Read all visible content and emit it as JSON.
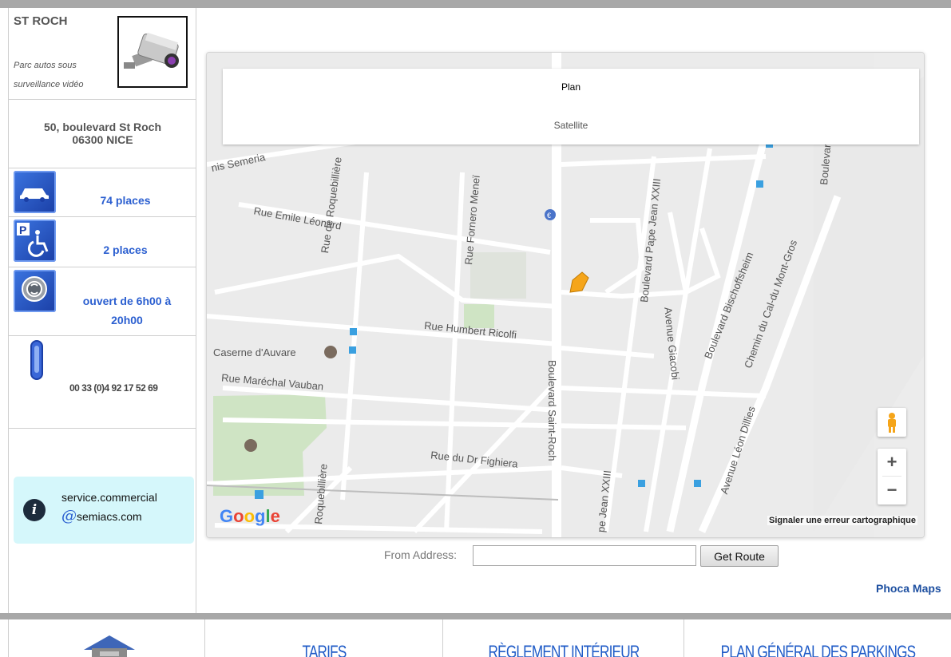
{
  "parking": {
    "name": "ST ROCH",
    "tagline_1": "Parc autos sous",
    "tagline_2": "surveillance vidéo",
    "address_line1": "50, boulevard St Roch",
    "address_line2": "06300 NICE",
    "places": "74 places",
    "disabled_places": "2 places",
    "hours_line1": "ouvert de 6h00 à",
    "hours_line2": "20h00",
    "phone": "00 33 (0)4 92 17 52 69",
    "email_user": "service.commercial",
    "email_domain": "semiacs.com",
    "email_at": "@"
  },
  "map": {
    "type_plan": "Plan",
    "type_satellite": "Satellite",
    "report_link": "Signaler une erreur cartographique",
    "zoom_in": "+",
    "zoom_out": "−",
    "google_g": "G",
    "google_o1": "o",
    "google_o2": "o",
    "google_g2": "g",
    "google_l": "l",
    "google_e": "e",
    "streets": {
      "s1": "nis Semeria",
      "s2": "Rue Emile Léonard",
      "s3": "Rue de Roquebillière",
      "s4": "Rue Fornero Meneï",
      "s5": "Boulevard Pape Jean XXIII",
      "s6": "Boulevard Bischoffsheim",
      "s7": "Chemin du Cal-du Mont-Gros",
      "s8": "Avenue Giacobi",
      "s9": "Rue Humbert Ricolfi",
      "s10": "Caserne d'Auvare",
      "s11": "Rue Maréchal Vauban",
      "s12": "Boulevard Saint-Roch",
      "s13": "Rue du Dr Fighiera",
      "s14": "Avenue Léon Dillies",
      "s15": "Roquebillière",
      "s16": "pe Jean XXIII",
      "s17": "Boulevar"
    }
  },
  "route": {
    "from_label": "From Address:",
    "from_value": "",
    "button": "Get Route"
  },
  "credit": "Phoca Maps",
  "footer_nav": {
    "tarifs": "TARIFS",
    "reglement": "RÈGLEMENT INTÉRIEUR",
    "plan": "PLAN GÉNÉRAL DES PARKINGS"
  },
  "colors": {
    "link_blue": "#2b5fd0",
    "info_bg": "#d5f7fb",
    "frame_gray": "#a8a8a8"
  }
}
